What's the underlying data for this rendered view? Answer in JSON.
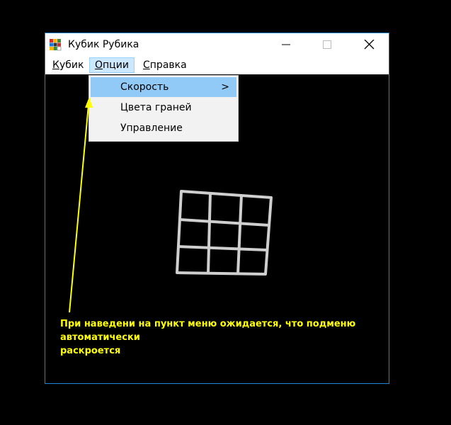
{
  "window": {
    "title": "Кубик Рубика",
    "accent_color": "#1e88d6",
    "controls": [
      "minimize-icon",
      "maximize-icon",
      "close-icon"
    ]
  },
  "menubar": {
    "items": [
      {
        "label_mnemonic": "К",
        "label_rest": "убик"
      },
      {
        "label_mnemonic": "О",
        "label_rest": "пции"
      },
      {
        "label_mnemonic": "С",
        "label_rest": "правка"
      }
    ]
  },
  "dropdown": {
    "items": [
      {
        "label": "Скорость",
        "submenu_arrow": ">"
      },
      {
        "label": "Цвета граней"
      },
      {
        "label": "Управление"
      }
    ],
    "highlight_color": "#91c9f7"
  },
  "annotation": {
    "text_line1": "При наведени на пункт меню ожидается, что подменю автоматически",
    "text_line2": "раскроется",
    "color": "#ffff00"
  }
}
